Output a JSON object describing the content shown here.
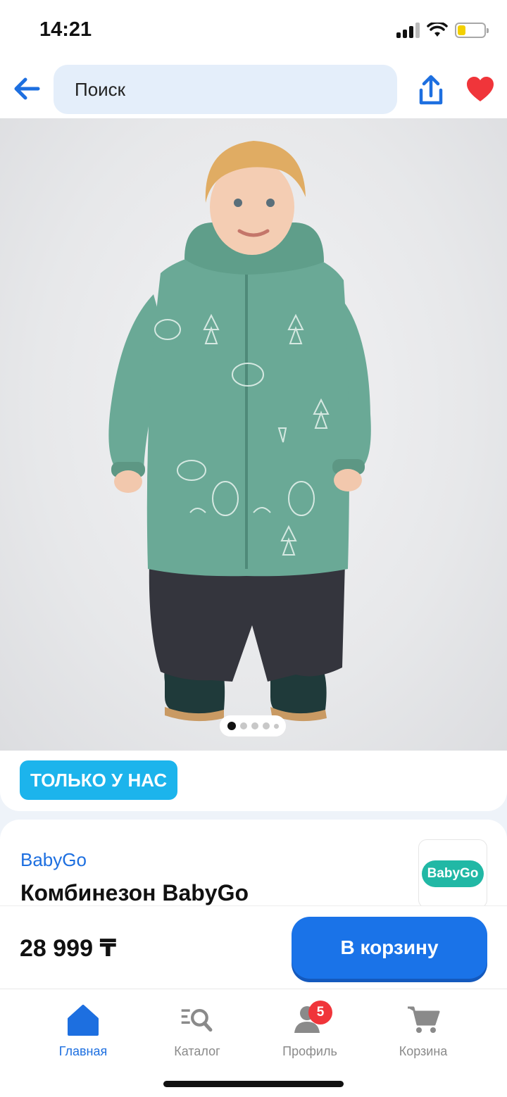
{
  "status_bar": {
    "time": "14:21"
  },
  "top_bar": {
    "search_placeholder": "Поиск"
  },
  "gallery": {
    "image_count": 5,
    "active_index": 0
  },
  "badge": {
    "label": "ТОЛЬКО У НАС"
  },
  "product": {
    "brand": "BabyGo",
    "title": "Комбинезон BabyGo",
    "brand_logo_text": "BabyGo",
    "price": "28 999 ₸"
  },
  "actions": {
    "add_to_cart": "В корзину"
  },
  "tabs": [
    {
      "label": "Главная",
      "icon": "home-icon",
      "active": true
    },
    {
      "label": "Каталог",
      "icon": "catalog-search-icon",
      "active": false
    },
    {
      "label": "Профиль",
      "icon": "profile-icon",
      "active": false,
      "badge": "5"
    },
    {
      "label": "Корзина",
      "icon": "cart-icon",
      "active": false
    }
  ],
  "colors": {
    "accent": "#1a73e8",
    "badge": "#1cb4ec",
    "favorite": "#f0353a",
    "brand_logo": "#21b8a5"
  }
}
